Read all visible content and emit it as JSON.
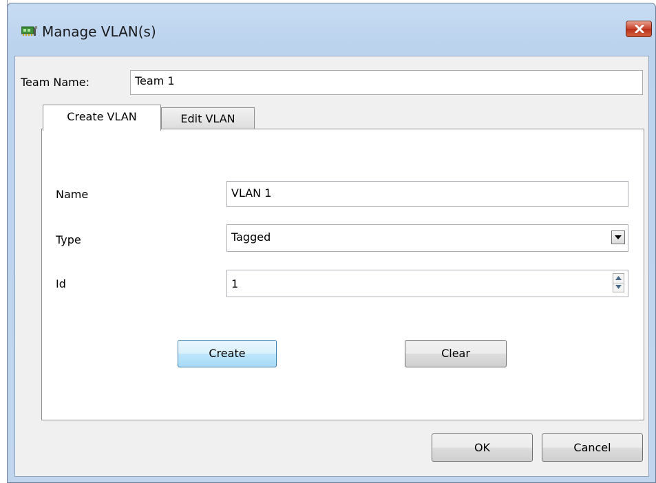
{
  "window": {
    "title": "Manage VLAN(s)",
    "accent_color": "#c7412a"
  },
  "team": {
    "label": "Team Name:",
    "value": "Team 1"
  },
  "tabs": [
    {
      "label": "Create VLAN",
      "active": true
    },
    {
      "label": "Edit VLAN",
      "active": false
    }
  ],
  "form": {
    "name_label": "Name",
    "name_value": "VLAN 1",
    "type_label": "Type",
    "type_value": "Tagged",
    "id_label": "Id",
    "id_value": "1"
  },
  "buttons": {
    "create": "Create",
    "clear": "Clear",
    "ok": "OK",
    "cancel": "Cancel"
  },
  "icons": {
    "app": "network-card-icon",
    "close": "close-icon",
    "dropdown": "chevron-down-icon",
    "spin_up": "arrow-up-icon",
    "spin_down": "arrow-down-icon"
  }
}
